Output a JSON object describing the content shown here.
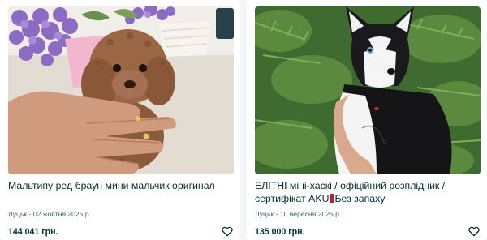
{
  "listings": [
    {
      "title": "Мальтипу ред браун мини мальчик оригинал",
      "location_date": "Луцьк - 02 жовтня 2025 р.",
      "price": "144 041 грн.",
      "image_label": "brown maltipoo puppy held in hand"
    },
    {
      "title_part1": "ЕЛІТНІ міні-хаскі / офіційний розплідник / сертифікат AKU",
      "title_part2": "Без запаху",
      "location_date": "Луцьк - 10 вересня 2025 р.",
      "price": "135 000 грн.",
      "image_label": "black and white husky puppy held in hand"
    }
  ],
  "icons": {
    "favorite": "heart-outline-icon",
    "title_marker": "red-square-emoji"
  },
  "colors": {
    "text": "#002f34",
    "muted": "#406367",
    "background": "#f2f4f5",
    "card": "#ffffff",
    "marker": "#b3202f"
  }
}
